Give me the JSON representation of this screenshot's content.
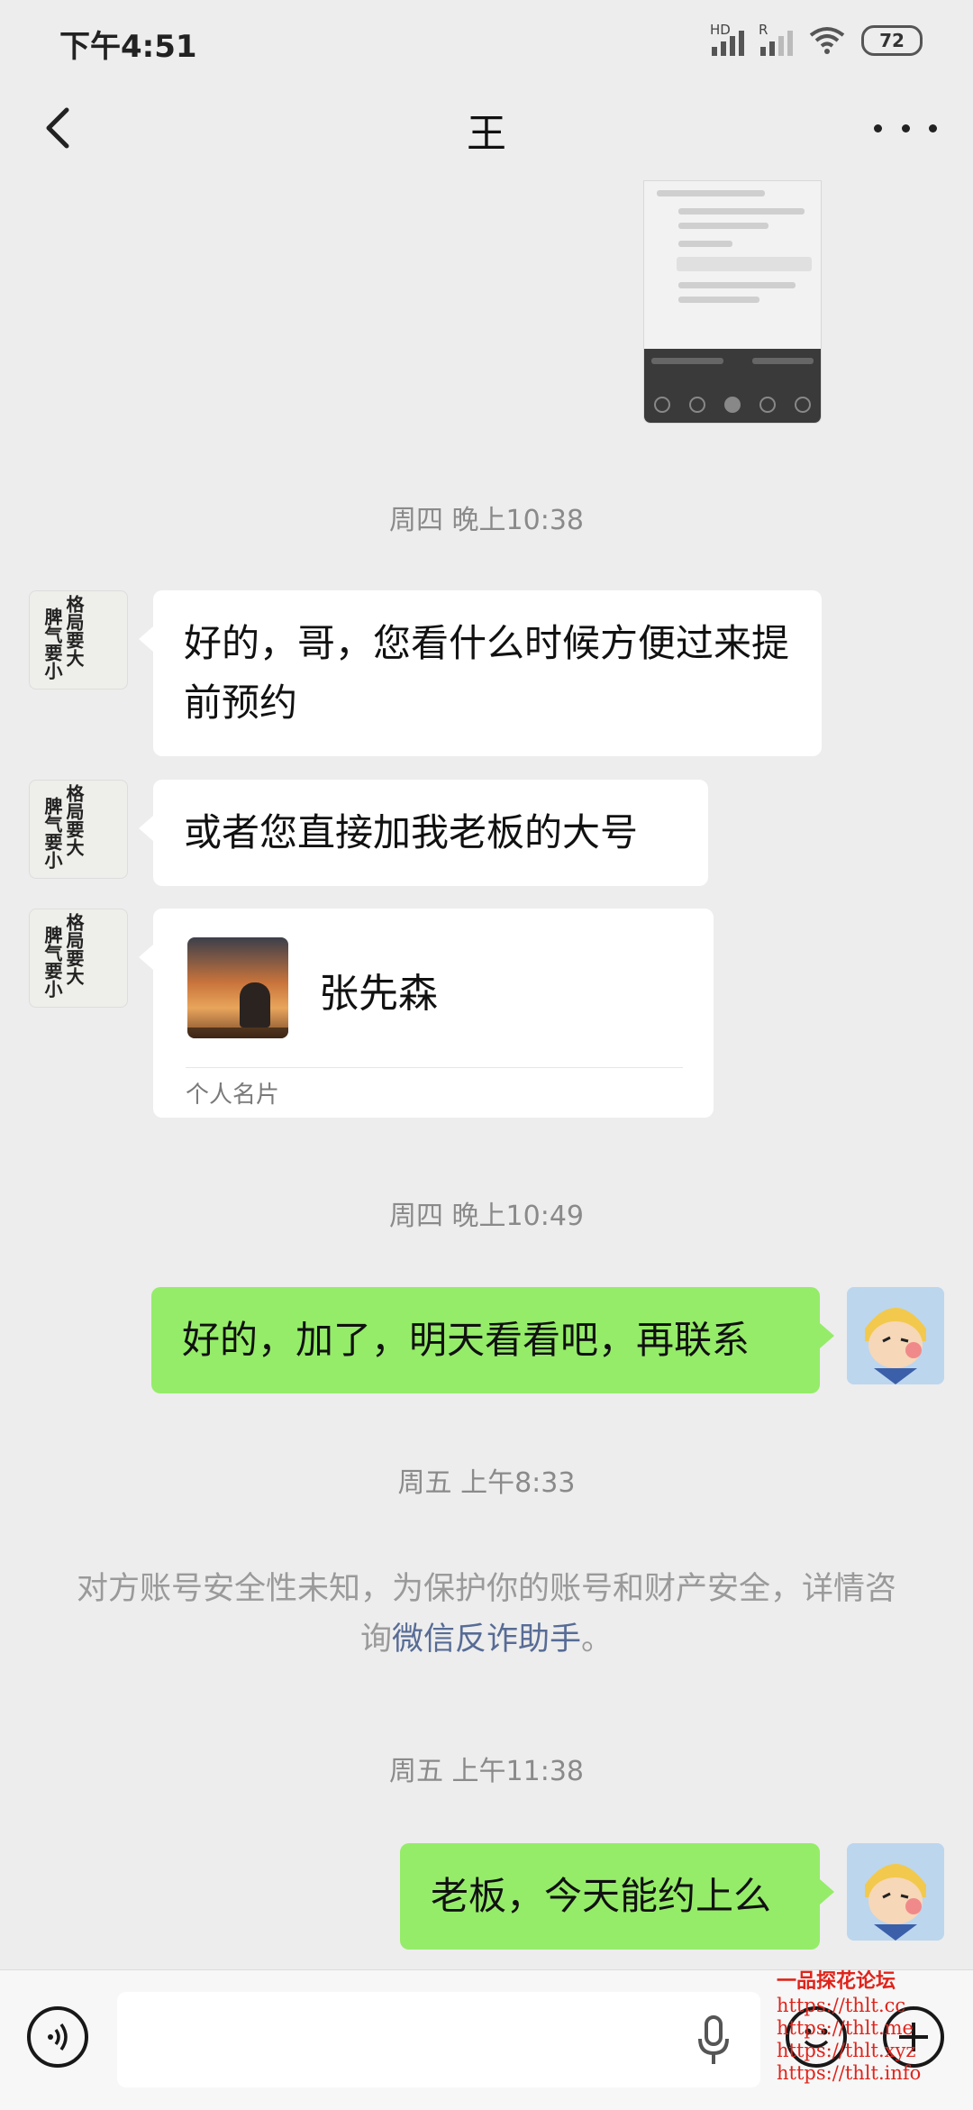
{
  "status_bar": {
    "time": "下午4:51",
    "network_1": "HD",
    "network_2": "R",
    "battery": "72"
  },
  "header": {
    "title": "王"
  },
  "messages": [
    {
      "type": "timestamp",
      "text": "周四 晚上10:38"
    },
    {
      "type": "incoming",
      "text": "好的，哥，您看什么时候方便过来提前预约"
    },
    {
      "type": "incoming",
      "text": "或者您直接加我老板的大号"
    },
    {
      "type": "contact_card",
      "name": "张先森",
      "label": "个人名片"
    },
    {
      "type": "timestamp",
      "text": "周四 晚上10:49"
    },
    {
      "type": "outgoing",
      "text": "好的，加了，明天看看吧，再联系"
    },
    {
      "type": "timestamp",
      "text": "周五 上午8:33"
    },
    {
      "type": "system",
      "text": "对方账号安全性未知，为保护你的账号和财产安全，详情咨询",
      "link": "微信反诈助手",
      "end": "。"
    },
    {
      "type": "timestamp",
      "text": "周五 上午11:38"
    },
    {
      "type": "outgoing",
      "text": "老板，今天能约上么"
    }
  ],
  "avatar_left_calligraphy": [
    "格局要大",
    "脾气要小"
  ],
  "watermark": {
    "title": "一品探花论坛",
    "lines": [
      "https://thlt.cc",
      "https://thlt.me",
      "https://thlt.xyz",
      "https://thlt.info"
    ]
  },
  "icons": {
    "back": "chevron-left-icon",
    "more": "more-dots-icon",
    "voice": "voice-mode-icon",
    "mic": "microphone-icon",
    "emoji": "emoji-icon",
    "plus": "plus-icon"
  },
  "colors": {
    "background": "#ededed",
    "outgoing_bubble": "#95ec69",
    "incoming_bubble": "#ffffff",
    "link": "#576b95",
    "watermark": "#e0241b"
  }
}
